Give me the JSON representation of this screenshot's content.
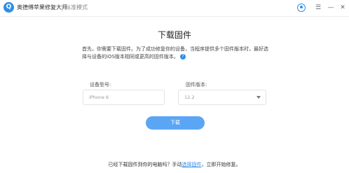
{
  "app": {
    "logo_glyph": "Q",
    "name": "奥德傅苹果修复大师",
    "mode": "标准模式"
  },
  "window_controls": {
    "avatar_icon": "user-avatar-icon",
    "menu_glyph": "☰",
    "minimize_glyph": "—",
    "close_glyph": "✕"
  },
  "main": {
    "heading": "下载固件",
    "description": "首先，你需要下载固件。为了成功修复你的设备，当程序提供多个固件版本时，最好选择与设备的iOS版本相同或更高的固件版本。",
    "help_glyph": "?"
  },
  "form": {
    "model_label": "设备型号:",
    "model_value": "iPhone 6",
    "version_label": "固件版本:",
    "version_value": "12.2"
  },
  "download_button": "下载",
  "footer": {
    "prefix": "已经下载固件到你的电脑吗？手动",
    "link": "选择固件",
    "suffix": "，立即开始修复。"
  },
  "colors": {
    "accent": "#2f8ee8",
    "button": "#5aa6f5"
  }
}
